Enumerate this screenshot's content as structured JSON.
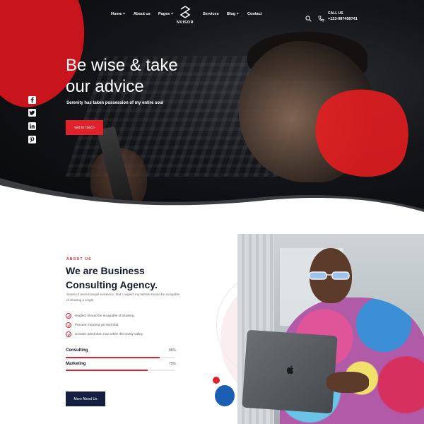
{
  "nav": {
    "items": [
      "Home +",
      "About us",
      "Pages +",
      "Services",
      "Blog +",
      "Contact"
    ],
    "logo_text": "NVISOR",
    "call_label": "CALL US",
    "call_number": "+123-987458741"
  },
  "hero": {
    "title_line1": "Be wise & take",
    "title_line2": "our advice",
    "subtitle": "Serenity has taken possession of my entire soul",
    "cta_label": "Get In Touch"
  },
  "social": [
    "facebook-icon",
    "twitter-icon",
    "linkedin-icon",
    "pinterest-icon"
  ],
  "about": {
    "eyebrow": "ABOUT US",
    "title_line1": "We are Business",
    "title_line2": "Consulting Agency.",
    "description": "Sense of mere tranquil existence, that I neglect my talents should be incapable of drawing a single",
    "checks": [
      "Neglect should be incapable of drawing",
      "Present moment yet feel that",
      "Greater artist than now while the lovely valley"
    ],
    "skills": [
      {
        "label": "Consulting",
        "percent_text": "86%",
        "value": 86
      },
      {
        "label": "Marketing",
        "percent_text": "75%",
        "value": 75
      }
    ],
    "button_label": "More About Us"
  },
  "colors": {
    "accent": "#e0222a",
    "navy": "#13203f"
  }
}
